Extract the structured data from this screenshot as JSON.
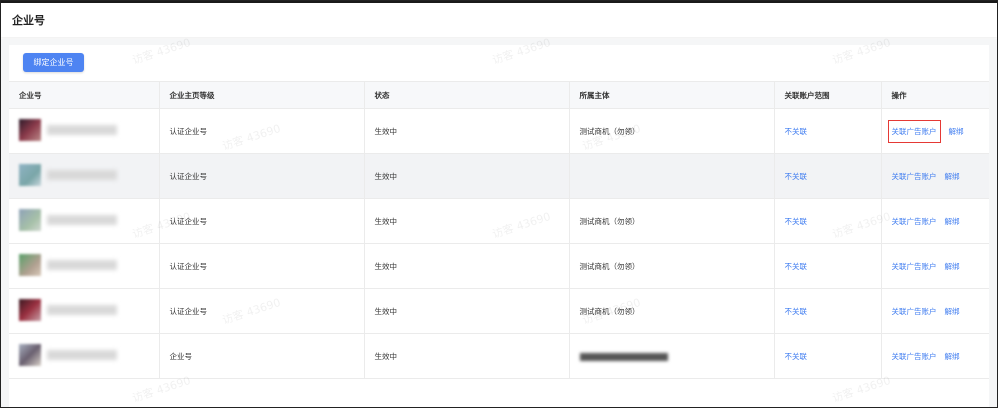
{
  "page": {
    "title": "企业号"
  },
  "toolbar": {
    "bind_label": "绑定企业号"
  },
  "table": {
    "columns": [
      "企业号",
      "企业主页等级",
      "状态",
      "所属主体",
      "关联账户范围",
      "操作"
    ],
    "rows": [
      {
        "level": "认证企业号",
        "status": "生效中",
        "subject": "测试商机（勿领）",
        "scope": "不关联",
        "op_link": "关联广告账户",
        "op_unbind": "解绑"
      },
      {
        "level": "认证企业号",
        "status": "生效中",
        "subject": "",
        "scope": "不关联",
        "op_link": "关联广告账户",
        "op_unbind": "解绑"
      },
      {
        "level": "认证企业号",
        "status": "生效中",
        "subject": "测试商机（勿领）",
        "scope": "不关联",
        "op_link": "关联广告账户",
        "op_unbind": "解绑"
      },
      {
        "level": "认证企业号",
        "status": "生效中",
        "subject": "测试商机（勿领）",
        "scope": "不关联",
        "op_link": "关联广告账户",
        "op_unbind": "解绑"
      },
      {
        "level": "认证企业号",
        "status": "生效中",
        "subject": "测试商机（勿领）",
        "scope": "不关联",
        "op_link": "关联广告账户",
        "op_unbind": "解绑"
      },
      {
        "level": "企业号",
        "status": "生效中",
        "subject": "",
        "scope": "不关联",
        "op_link": "关联广告账户",
        "op_unbind": "解绑"
      }
    ]
  },
  "watermark": "访客 43690",
  "colors": {
    "primary": "#4e84f2",
    "link": "#3d7bf0",
    "highlight_border": "#e53935"
  }
}
